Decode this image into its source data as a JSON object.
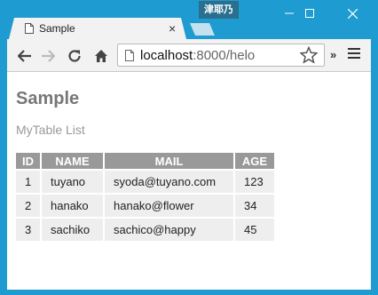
{
  "window": {
    "user_badge": "津耶乃"
  },
  "tab": {
    "title": "Sample",
    "close_glyph": "×"
  },
  "toolbar": {
    "url_host": "localhost",
    "url_path": ":8000/helo",
    "overflow_glyph": "»"
  },
  "page": {
    "title": "Sample",
    "subtitle": "MyTable List"
  },
  "table": {
    "headers": [
      "ID",
      "NAME",
      "MAIL",
      "AGE"
    ],
    "rows": [
      [
        "1",
        "tuyano",
        "syoda@tuyano.com",
        "123"
      ],
      [
        "2",
        "hanako",
        "hanako@flower",
        "34"
      ],
      [
        "3",
        "sachiko",
        "sachico@happy",
        "45"
      ]
    ]
  },
  "colors": {
    "window_frame": "#1e9bd0",
    "table_header_bg": "#999999",
    "table_cell_bg": "#eeeeee",
    "page_title": "#777777"
  }
}
